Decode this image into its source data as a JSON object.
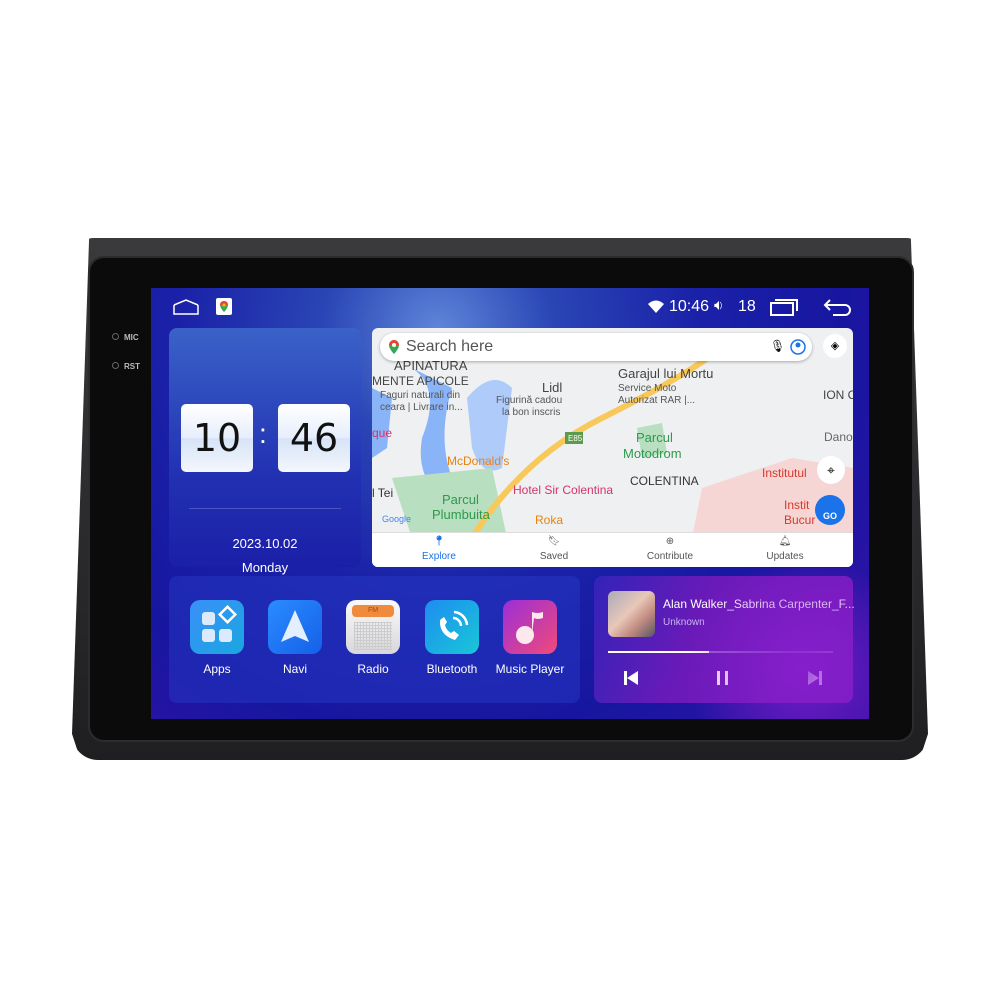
{
  "device": {
    "mic_label": "MIC",
    "rst_label": "RST"
  },
  "status_bar": {
    "time": "10:46",
    "volume": "18",
    "icons": [
      "home-icon",
      "google-maps-icon",
      "wifi-icon",
      "volume-icon",
      "recents-icon",
      "back-icon"
    ]
  },
  "clock_widget": {
    "hours": "10",
    "minutes": "46",
    "separator": ":",
    "date": "2023.10.02",
    "weekday": "Monday"
  },
  "map_widget": {
    "search_placeholder": "Search here",
    "tabs": [
      {
        "label": "Explore",
        "active": true
      },
      {
        "label": "Saved"
      },
      {
        "label": "Contribute"
      },
      {
        "label": "Updates"
      }
    ],
    "labels": [
      "APINATURA",
      "MENTE APICOLE",
      "Faguri naturali din",
      "ceara | Livrare in...",
      "Lidl",
      "Figurină cadou",
      "la bon inscris",
      "Garajul lui Mortu",
      "Service Moto",
      "Autorizat RAR |...",
      "ION C",
      "Dano",
      "que",
      "E85",
      "Parcul",
      "Motodrom",
      "McDonald's",
      "COLENTINA",
      "Institutul",
      "l Tei",
      "Hotel Sir Colentina",
      "Parcul",
      "Plumbuita",
      "Roka",
      "Instit",
      "Bucur",
      "Google",
      "GO"
    ],
    "accent": "#1a73e8"
  },
  "apps": [
    {
      "label": "Apps",
      "icon": "apps-grid-icon"
    },
    {
      "label": "Navi",
      "icon": "navigation-arrow-icon"
    },
    {
      "label": "Radio",
      "icon": "radio-fm-icon",
      "badge": "FM"
    },
    {
      "label": "Bluetooth",
      "icon": "bluetooth-phone-icon"
    },
    {
      "label": "Music Player",
      "icon": "music-note-icon"
    }
  ],
  "music": {
    "title": "Alan Walker_Sabrina Carpenter_F...",
    "artist": "Unknown",
    "progress": 0.45
  }
}
